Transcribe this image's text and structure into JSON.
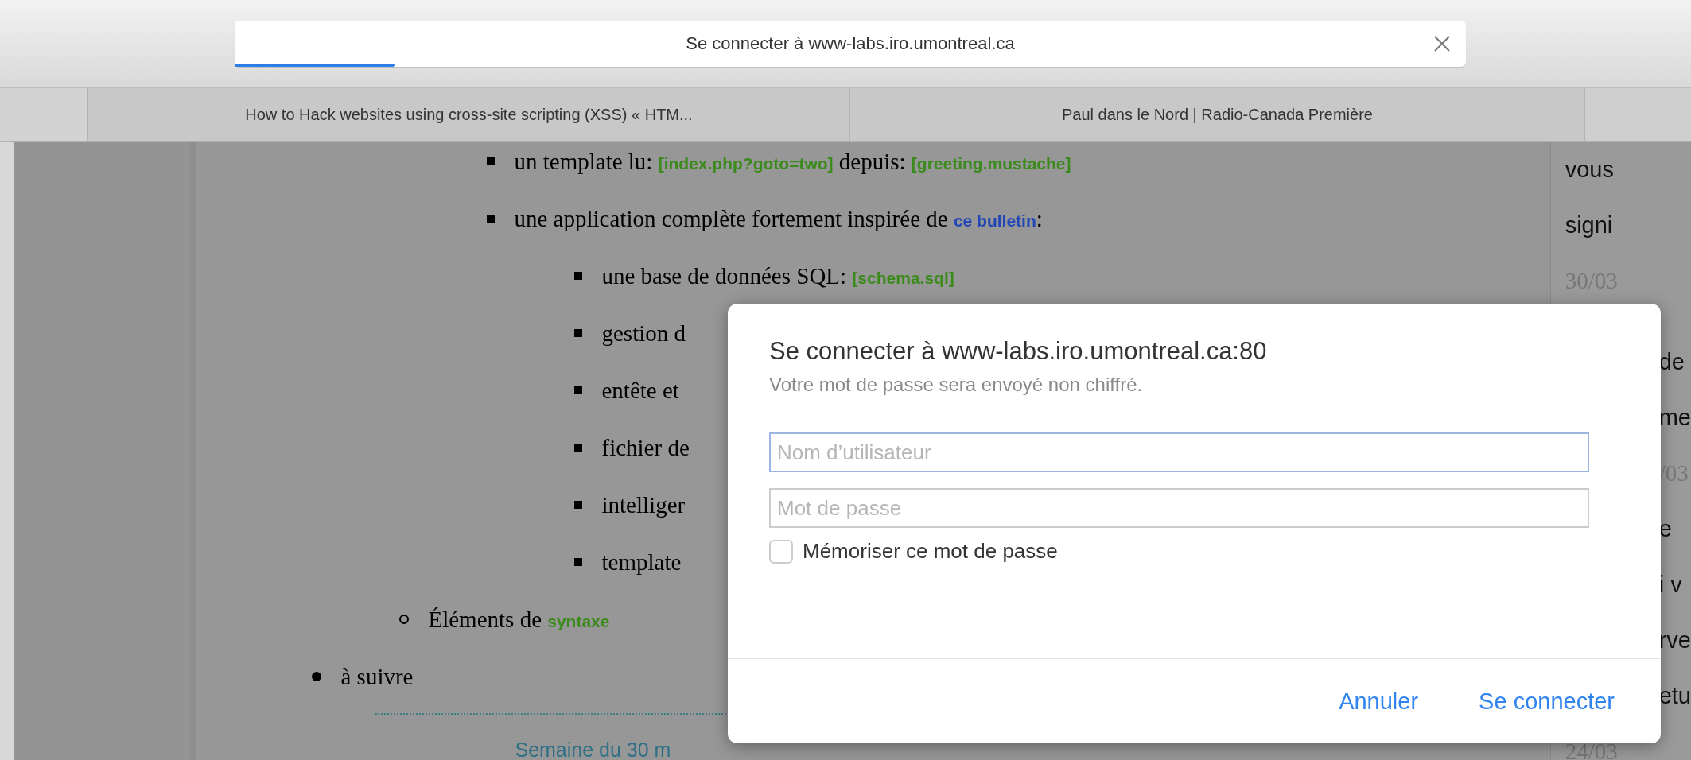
{
  "browser": {
    "address_bar": {
      "title": "Se connecter à www-labs.iro.umontreal.ca",
      "level": 0.13
    },
    "tabs": [
      {
        "label": "How to Hack websites using cross-site scripting (XSS) « HTM...",
        "selected": false
      },
      {
        "label": "Paul dans le Nord | Radio-Canada Première",
        "selected": false
      }
    ]
  },
  "outline": [
    {
      "children": [
        {
          "children": [
            {
              "parts": [
                {
                  "kind": "text",
                  "text": "un template lu: "
                },
                {
                  "kind": "file",
                  "text": "[index.php?goto=two]"
                },
                {
                  "kind": "text",
                  "text": " depuis: "
                },
                {
                  "kind": "file",
                  "text": "[greeting.mustache]"
                }
              ]
            },
            {
              "parts": [
                {
                  "kind": "text",
                  "text": "une application complète fortement inspirée de "
                },
                {
                  "kind": "link",
                  "text": "ce bulletin"
                },
                {
                  "kind": "text",
                  "text": ":"
                }
              ],
              "children": [
                {
                  "parts": [
                    {
                      "kind": "text",
                      "text": "une base de données SQL: "
                    },
                    {
                      "kind": "file",
                      "text": "[schema.sql]"
                    }
                  ]
                },
                {
                  "parts": [
                    {
                      "kind": "text",
                      "text": "gestion d"
                    }
                  ]
                },
                {
                  "parts": [
                    {
                      "kind": "text",
                      "text": "entête et"
                    }
                  ]
                },
                {
                  "parts": [
                    {
                      "kind": "text",
                      "text": "fichier de"
                    }
                  ]
                },
                {
                  "parts": [
                    {
                      "kind": "text",
                      "text": "intelliger"
                    }
                  ]
                },
                {
                  "parts": [
                    {
                      "kind": "text",
                      "text": "template"
                    }
                  ]
                }
              ]
            }
          ]
        },
        {
          "parts": [
            {
              "kind": "text",
              "text": "Éléments de "
            },
            {
              "kind": "file",
              "text": "syntaxe"
            }
          ]
        }
      ]
    },
    {
      "parts": [
        {
          "kind": "text",
          "text": "à suivre"
        }
      ]
    }
  ],
  "week_heading": "Semaine du 30 m",
  "right_column": [
    {
      "kind": "text",
      "text": "vous",
      "covered": false
    },
    {
      "kind": "text",
      "text": "signi",
      "covered": false
    },
    {
      "kind": "date",
      "text": "30/03",
      "covered": false
    },
    {
      "kind": "text",
      "text": "de",
      "covered": true
    },
    {
      "kind": "text",
      "text": "me",
      "covered": true
    },
    {
      "kind": "date",
      "text": "/03",
      "covered": true
    },
    {
      "kind": "text",
      "text": "e",
      "covered": true
    },
    {
      "kind": "text",
      "text": "i v",
      "covered": true
    },
    {
      "kind": "text",
      "text": "rve",
      "covered": true
    },
    {
      "kind": "text",
      "text": "etu",
      "covered": true
    },
    {
      "kind": "date",
      "text": "24/03",
      "covered": false
    }
  ],
  "dialog": {
    "title": "Se connecter à www-labs.iro.umontreal.ca:80",
    "subtitle": "Votre mot de passe sera envoyé non chiffré.",
    "username": {
      "placeholder": "Nom d’utilisateur"
    },
    "password": {
      "placeholder": "Mot de passe"
    },
    "remember": {
      "label": "Mémoriser ce mot de passe",
      "checked": false
    },
    "buttons": [
      {
        "label": "Annuler"
      },
      {
        "label": "Se connecter"
      }
    ]
  }
}
